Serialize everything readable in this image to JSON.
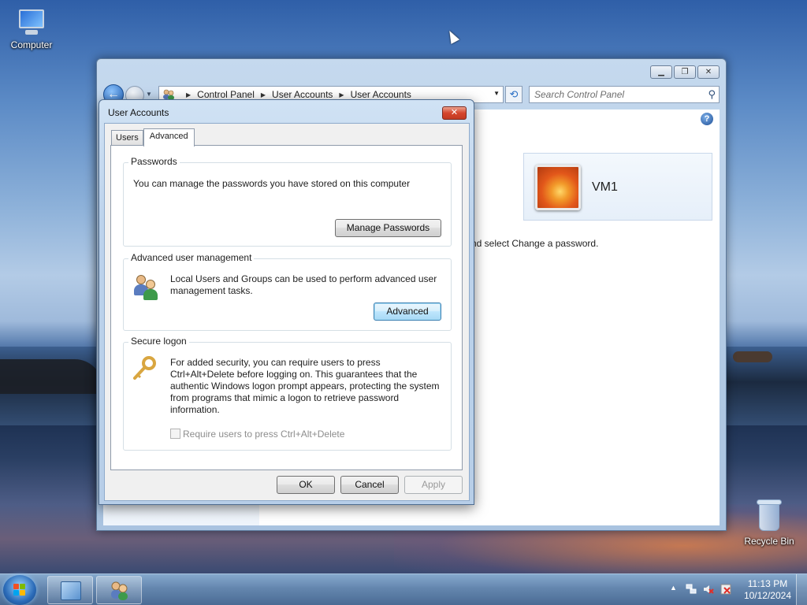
{
  "desktop": {
    "icons": [
      {
        "label": "Computer"
      },
      {
        "label": "Recycle Bin"
      }
    ]
  },
  "control_panel": {
    "breadcrumb": [
      "Control Panel",
      "User Accounts",
      "User Accounts"
    ],
    "search_placeholder": "Search Control Panel",
    "user_name": "VM1",
    "hint_text": "nd select Change a password."
  },
  "dialog": {
    "title": "User Accounts",
    "tabs": [
      {
        "label": "Users",
        "active": false
      },
      {
        "label": "Advanced",
        "active": true
      }
    ],
    "passwords": {
      "title": "Passwords",
      "text": "You can manage the passwords you have stored on this computer",
      "button": "Manage Passwords"
    },
    "advanced_mgmt": {
      "title": "Advanced user management",
      "text": "Local Users and Groups can be used to perform advanced user management tasks.",
      "button": "Advanced"
    },
    "secure_logon": {
      "title": "Secure logon",
      "text": "For added security, you can require users to press Ctrl+Alt+Delete before logging on. This guarantees that the authentic Windows logon prompt appears, protecting the system from programs that mimic a logon to retrieve password information.",
      "checkbox_label": "Require users to press Ctrl+Alt+Delete",
      "checkbox_checked": false,
      "checkbox_enabled": false
    },
    "buttons": {
      "ok": "OK",
      "cancel": "Cancel",
      "apply": "Apply"
    }
  },
  "taskbar": {
    "time": "11:13 PM",
    "date": "10/12/2024"
  }
}
